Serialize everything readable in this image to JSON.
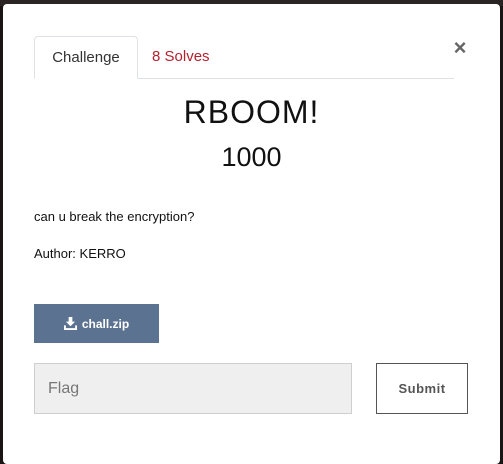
{
  "tabs": {
    "challenge_label": "Challenge",
    "solves_label": "8 Solves"
  },
  "close": {
    "icon": "×"
  },
  "challenge": {
    "name": "RBOOM!",
    "points": "1000",
    "description": "can u break the encryption?",
    "author": "Author: KERRO",
    "file_label": "chall.zip",
    "file_icon": "download-icon"
  },
  "flag_input": {
    "placeholder": "Flag",
    "value": ""
  },
  "submit_label": "Submit",
  "colors": {
    "solves_text": "#b5202e",
    "file_button_bg": "#5b7290",
    "input_bg": "#efefef"
  }
}
